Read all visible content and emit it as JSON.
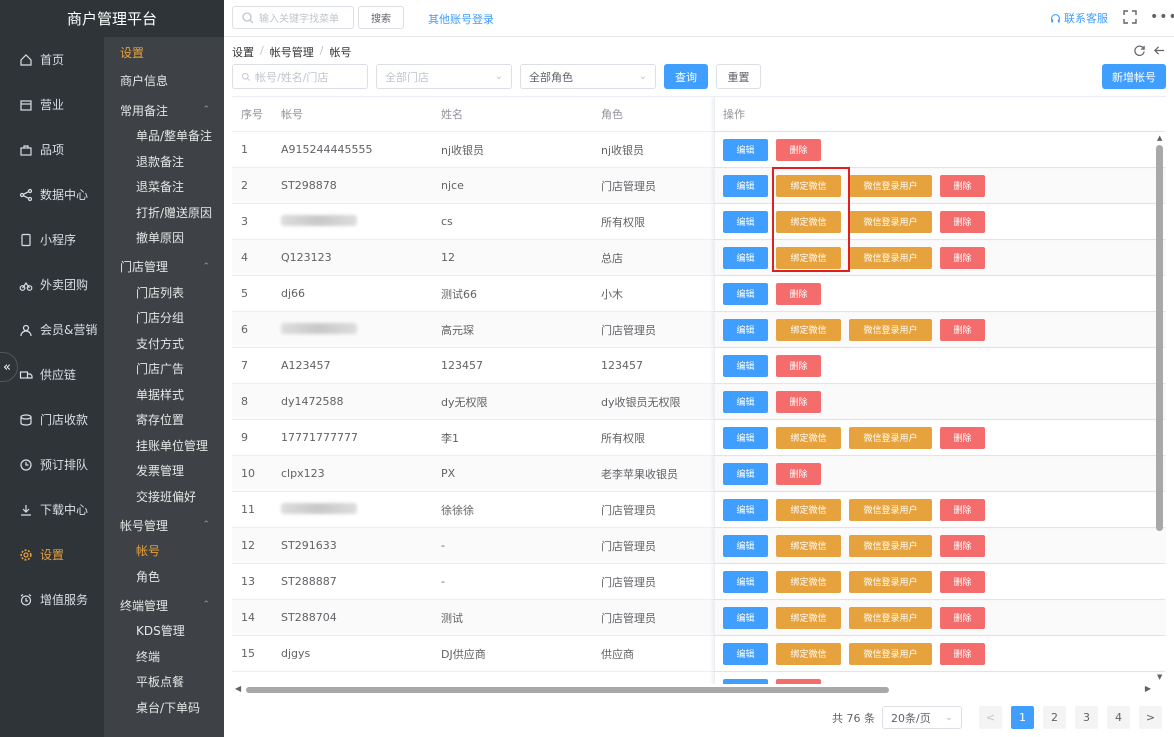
{
  "brand": "商户管理平台",
  "nav": [
    {
      "label": "首页",
      "icon": "home-icon"
    },
    {
      "label": "营业",
      "icon": "calendar-icon"
    },
    {
      "label": "品项",
      "icon": "bag-icon"
    },
    {
      "label": "数据中心",
      "icon": "share-icon"
    },
    {
      "label": "小程序",
      "icon": "phone-icon"
    },
    {
      "label": "外卖团购",
      "icon": "bike-icon"
    },
    {
      "label": "会员&营销",
      "icon": "user-icon"
    },
    {
      "label": "供应链",
      "icon": "truck-icon"
    },
    {
      "label": "门店收款",
      "icon": "coins-icon"
    },
    {
      "label": "预订排队",
      "icon": "clock-icon"
    },
    {
      "label": "下载中心",
      "icon": "download-icon"
    },
    {
      "label": "设置",
      "icon": "gear-icon"
    },
    {
      "label": "增值服务",
      "icon": "alarm-icon"
    }
  ],
  "subnav": {
    "top": "设置",
    "shop_info": "商户信息",
    "groups": [
      {
        "title": "常用备注",
        "items": [
          "单品/整单备注",
          "退款备注",
          "退菜备注",
          "打折/赠送原因",
          "撤单原因"
        ]
      },
      {
        "title": "门店管理",
        "items": [
          "门店列表",
          "门店分组",
          "支付方式",
          "门店广告",
          "单据样式",
          "寄存位置",
          "挂账单位管理",
          "发票管理",
          "交接班偏好"
        ]
      },
      {
        "title": "帐号管理",
        "items": [
          "帐号",
          "角色"
        ]
      },
      {
        "title": "终端管理",
        "items": [
          "KDS管理",
          "终端",
          "平板点餐",
          "桌台/下单码"
        ]
      }
    ]
  },
  "topbar": {
    "search_placeholder": "输入关键字找菜单",
    "search_button": "搜索",
    "other_login": "其他账号登录",
    "support": "联系客服",
    "more": "•••"
  },
  "breadcrumb": [
    "设置",
    "帐号管理",
    "帐号"
  ],
  "filter": {
    "keyword_placeholder": "帐号/姓名/门店",
    "store_placeholder": "全部门店",
    "role_value": "全部角色",
    "query_button": "查询",
    "reset_button": "重置",
    "add_button": "新增帐号"
  },
  "table": {
    "headers": [
      "序号",
      "帐号",
      "姓名",
      "角色",
      "操作"
    ],
    "actions": {
      "edit": "编辑",
      "bind": "绑定微信",
      "wx_user": "微信登录用户",
      "delete": "删除"
    },
    "rows": [
      {
        "no": "1",
        "account": "A915244445555",
        "name": "nj收银员",
        "role": "nj收银员",
        "full": false
      },
      {
        "no": "2",
        "account": "ST298878",
        "name": "njce",
        "role": "门店管理员",
        "full": true
      },
      {
        "no": "3",
        "account": "",
        "name": "cs",
        "role": "所有权限",
        "full": true
      },
      {
        "no": "4",
        "account": "Q123123",
        "name": "12",
        "role": "总店",
        "full": true
      },
      {
        "no": "5",
        "account": "dj66",
        "name": "测试66",
        "role": "小木",
        "full": false
      },
      {
        "no": "6",
        "account": "",
        "name": "高元琛",
        "role": "门店管理员",
        "full": true
      },
      {
        "no": "7",
        "account": "A123457",
        "name": "123457",
        "role": "123457",
        "full": false
      },
      {
        "no": "8",
        "account": "dy1472588",
        "name": "dy无权限",
        "role": "dy收银员无权限",
        "full": false
      },
      {
        "no": "9",
        "account": "17771777777",
        "name": "李1",
        "role": "所有权限",
        "full": true
      },
      {
        "no": "10",
        "account": "clpx123",
        "name": "PX",
        "role": "老李苹果收银员",
        "full": false
      },
      {
        "no": "11",
        "account": "",
        "name": "徐徐徐",
        "role": "门店管理员",
        "full": true
      },
      {
        "no": "12",
        "account": "ST291633",
        "name": "-",
        "role": "门店管理员",
        "full": true
      },
      {
        "no": "13",
        "account": "ST288887",
        "name": "-",
        "role": "门店管理员",
        "full": true
      },
      {
        "no": "14",
        "account": "ST288704",
        "name": "测试",
        "role": "门店管理员",
        "full": true
      },
      {
        "no": "15",
        "account": "djgys",
        "name": "DJ供应商",
        "role": "供应商",
        "full": true
      }
    ]
  },
  "pagination": {
    "total": "共 76 条",
    "page_size": "20条/页",
    "pages": [
      "1",
      "2",
      "3",
      "4"
    ],
    "current": "1",
    "prev": "<",
    "next": ">"
  }
}
